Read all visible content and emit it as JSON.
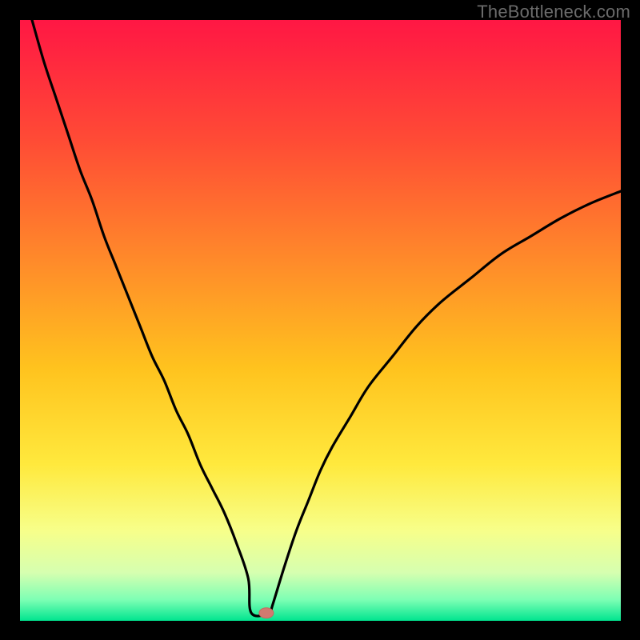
{
  "watermark": "TheBottleneck.com",
  "colors": {
    "background": "#000000",
    "curve": "#000000",
    "marker_fill": "#d17a70",
    "marker_stroke": "#c46a60",
    "gradient_stops": [
      {
        "offset": 0.0,
        "color": "#ff1744"
      },
      {
        "offset": 0.2,
        "color": "#ff4b35"
      },
      {
        "offset": 0.4,
        "color": "#ff8a2a"
      },
      {
        "offset": 0.58,
        "color": "#ffc31e"
      },
      {
        "offset": 0.74,
        "color": "#ffe93d"
      },
      {
        "offset": 0.85,
        "color": "#f7ff8a"
      },
      {
        "offset": 0.92,
        "color": "#d6ffb0"
      },
      {
        "offset": 0.965,
        "color": "#7dffb4"
      },
      {
        "offset": 1.0,
        "color": "#00e58f"
      }
    ]
  },
  "chart_data": {
    "type": "line",
    "title": "",
    "xlabel": "",
    "ylabel": "",
    "xlim": [
      0,
      100
    ],
    "ylim": [
      0,
      100
    ],
    "series": [
      {
        "name": "bottleneck-curve",
        "x": [
          2,
          4,
          6,
          8,
          10,
          12,
          14,
          16,
          18,
          20,
          22,
          24,
          26,
          28,
          30,
          32,
          34,
          36,
          38,
          38.5,
          41.5,
          42,
          44,
          46,
          48,
          50,
          52,
          55,
          58,
          62,
          66,
          70,
          75,
          80,
          85,
          90,
          95,
          100
        ],
        "y": [
          100,
          93,
          87,
          81,
          75,
          70,
          64,
          59,
          54,
          49,
          44,
          40,
          35,
          31,
          26,
          22,
          18,
          13,
          7,
          1.3,
          1.3,
          2.5,
          9,
          15,
          20,
          25,
          29,
          34,
          39,
          44,
          49,
          53,
          57,
          61,
          64,
          67,
          69.5,
          71.5
        ]
      }
    ],
    "flat_bottom": {
      "x_start": 38.5,
      "x_end": 41.5,
      "y": 1.3
    },
    "markers": [
      {
        "name": "optimal-point",
        "x": 41,
        "y": 1.3
      }
    ]
  }
}
